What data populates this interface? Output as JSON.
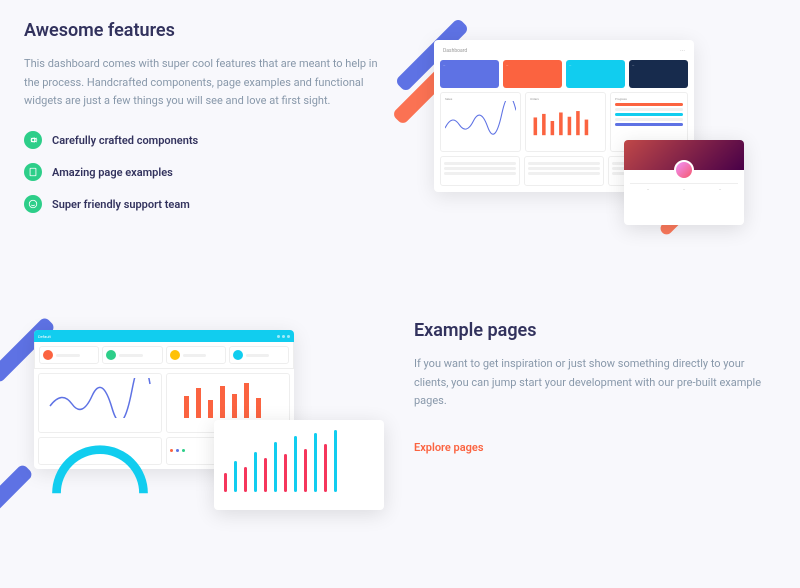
{
  "features": {
    "heading": "Awesome features",
    "description": "This dashboard comes with super cool features that are meant to help in the process. Handcrafted components, page examples and functional widgets are just a few things you will see and love at first sight.",
    "items": [
      "Carefully crafted components",
      "Amazing page examples",
      "Super friendly support team"
    ]
  },
  "pages": {
    "heading": "Example pages",
    "description": "If you want to get inspiration or just show something directly to your clients, you can jump start your development with our pre-built example pages.",
    "link_label": "Explore pages"
  },
  "colors": {
    "primary": "#5e72e4",
    "orange": "#fb6340",
    "teal": "#11cdef",
    "navy": "#172b4d",
    "success": "#2dce89",
    "text": "#32325d",
    "muted": "#8898aa"
  }
}
